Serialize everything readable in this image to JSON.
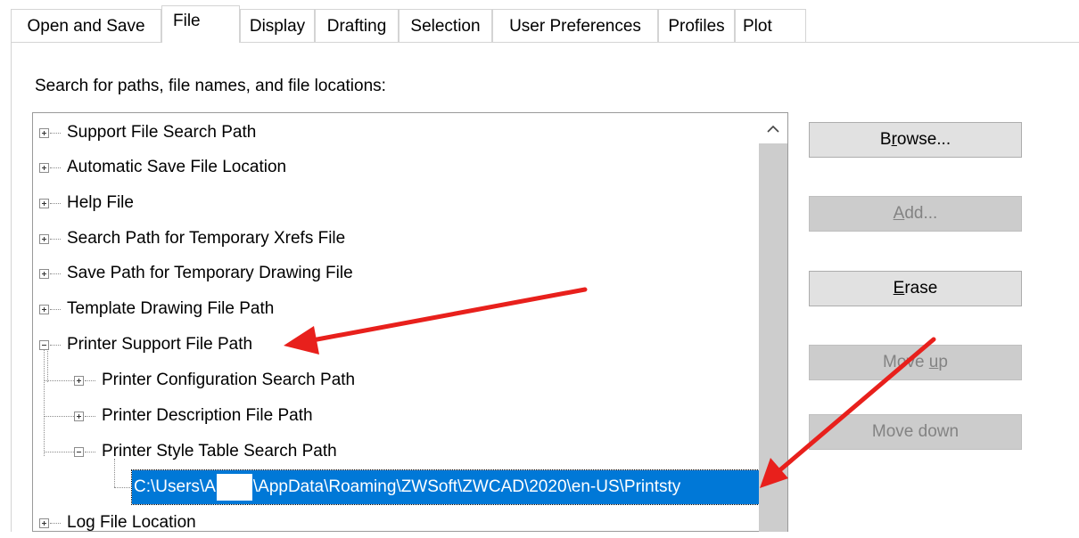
{
  "tabs": [
    {
      "label": "Open and Save"
    },
    {
      "label": "File"
    },
    {
      "label": "Display"
    },
    {
      "label": "Drafting"
    },
    {
      "label": "Selection"
    },
    {
      "label": "User Preferences"
    },
    {
      "label": "Profiles"
    },
    {
      "label": "Plot"
    }
  ],
  "active_tab": "File",
  "caption": "Search for paths, file names, and file locations:",
  "tree": {
    "items": [
      {
        "label": "Support File Search Path",
        "state": "collapsed"
      },
      {
        "label": "Automatic Save File Location",
        "state": "collapsed"
      },
      {
        "label": "Help File",
        "state": "collapsed"
      },
      {
        "label": "Search Path for Temporary Xrefs File",
        "state": "collapsed"
      },
      {
        "label": "Save Path for Temporary Drawing File",
        "state": "collapsed"
      },
      {
        "label": "Template Drawing File Path",
        "state": "collapsed"
      },
      {
        "label": "Printer Support File Path",
        "state": "expanded"
      },
      {
        "label": "Printer Configuration Search Path",
        "state": "collapsed"
      },
      {
        "label": "Printer Description File Path",
        "state": "collapsed"
      },
      {
        "label": "Printer Style Table Search Path",
        "state": "expanded"
      },
      {
        "label": "Log File Location",
        "state": "collapsed"
      }
    ],
    "selected_path_prefix": "C:\\Users\\",
    "selected_path_visible_initial": "A",
    "selected_path_suffix": "\\AppData\\Roaming\\ZWSoft\\ZWCAD\\2020\\en-US\\Printsty"
  },
  "buttons": {
    "browse": {
      "label": "Browse...",
      "enabled": true
    },
    "add": {
      "label": "Add...",
      "enabled": false
    },
    "erase": {
      "label": "Erase",
      "enabled": true
    },
    "move_up": {
      "label": "Move up",
      "enabled": false
    },
    "move_down": {
      "label": "Move down",
      "enabled": false
    }
  },
  "colors": {
    "selection": "#0078d7",
    "annotation_arrow": "#e8201c",
    "button_face": "#e1e1e1",
    "button_disabled": "#cccccc"
  }
}
